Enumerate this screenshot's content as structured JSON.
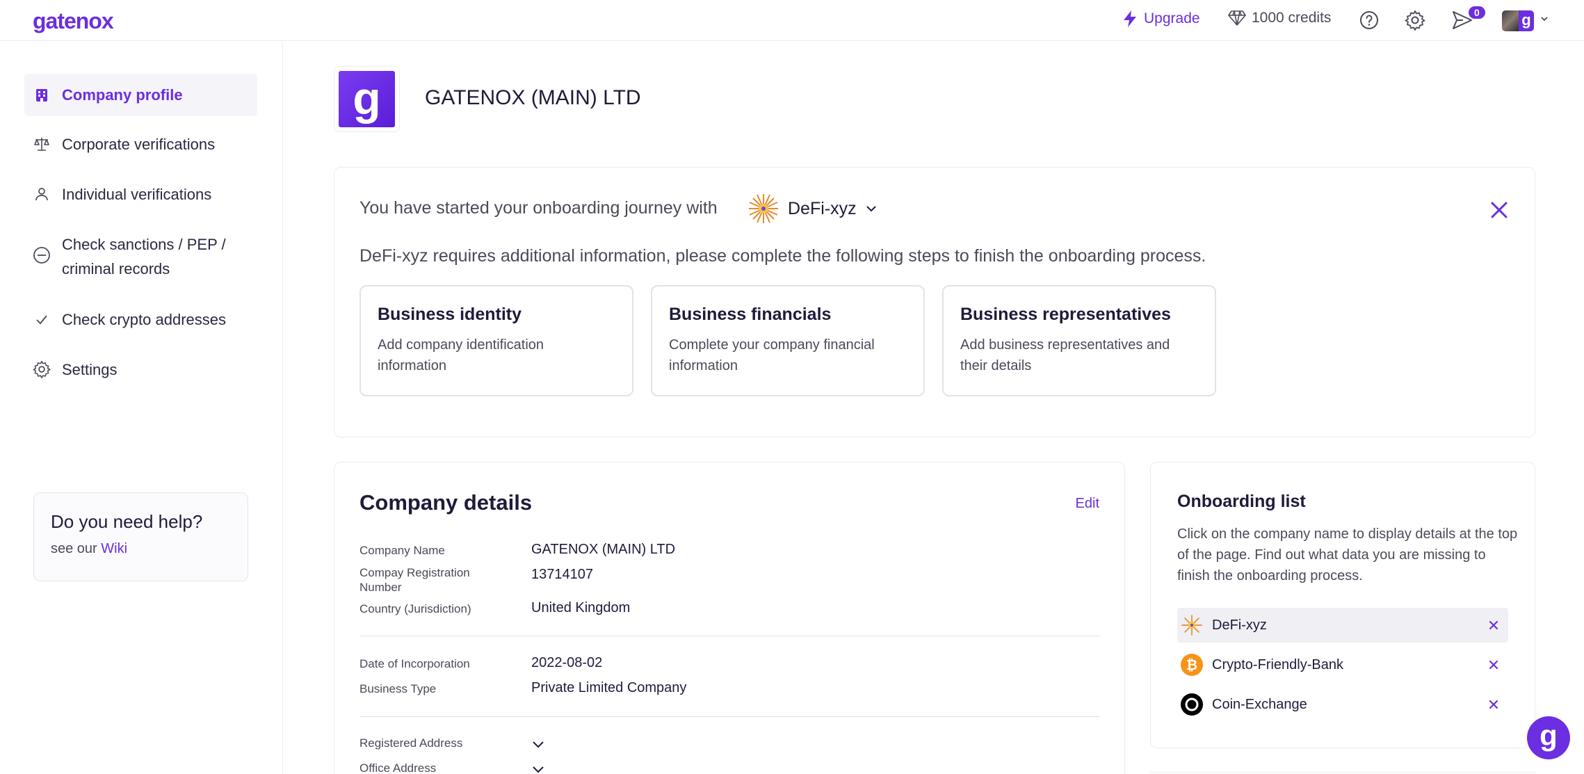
{
  "app": {
    "logo": "gatenox"
  },
  "topbar": {
    "upgrade_label": "Upgrade",
    "credits_label": "1000 credits",
    "notifications_count": "0",
    "avatar_letter": "g"
  },
  "sidebar": {
    "items": [
      {
        "label": "Company profile",
        "icon": "building-icon",
        "active": true
      },
      {
        "label": "Corporate verifications",
        "icon": "scale-icon"
      },
      {
        "label": "Individual verifications",
        "icon": "user-icon"
      },
      {
        "label": "Check sanctions / PEP / criminal records",
        "icon": "minus-circle-icon"
      },
      {
        "label": "Check crypto addresses",
        "icon": "check-icon"
      },
      {
        "label": "Settings",
        "icon": "gear-icon"
      }
    ],
    "help": {
      "title": "Do you need help?",
      "prefix": "see our ",
      "link": "Wiki"
    }
  },
  "company": {
    "logo_letter": "g",
    "title": "GATENOX (MAIN) LTD"
  },
  "banner": {
    "intro": "You have started your onboarding journey with",
    "provider": "DeFi-xyz",
    "message": "DeFi-xyz requires additional information, please complete the following steps to finish the onboarding process.",
    "steps": [
      {
        "title": "Business identity",
        "desc": "Add company identification information"
      },
      {
        "title": "Business financials",
        "desc": "Complete your company financial information"
      },
      {
        "title": "Business representatives",
        "desc": "Add business representatives and their details"
      }
    ]
  },
  "details": {
    "title": "Company details",
    "edit_label": "Edit",
    "fields": [
      {
        "label": "Company Name",
        "value": "GATENOX (MAIN) LTD"
      },
      {
        "label": "Compay Registration Number",
        "value": "13714107"
      },
      {
        "label": "Country (Jurisdiction)",
        "value": "United Kingdom"
      },
      {
        "label": "Date of Incorporation",
        "value": "2022-08-02"
      },
      {
        "label": "Business Type",
        "value": "Private Limited Company"
      },
      {
        "label": "Registered Address"
      },
      {
        "label": "Office Address"
      }
    ]
  },
  "onboarding": {
    "title": "Onboarding list",
    "desc": "Click on the company name to display details at the top of the page. Find out what data you are missing to finish the onboarding process.",
    "items": [
      {
        "name": "DeFi-xyz",
        "selected": true,
        "icon": "defi-sun-icon"
      },
      {
        "name": "Crypto-Friendly-Bank",
        "icon": "bitcoin-icon"
      },
      {
        "name": "Coin-Exchange",
        "icon": "ring-icon"
      }
    ]
  },
  "colors": {
    "accent": "#6b2ee0",
    "text": "#1e1b3a",
    "muted": "#4a4a5a",
    "border": "#ececf1"
  }
}
